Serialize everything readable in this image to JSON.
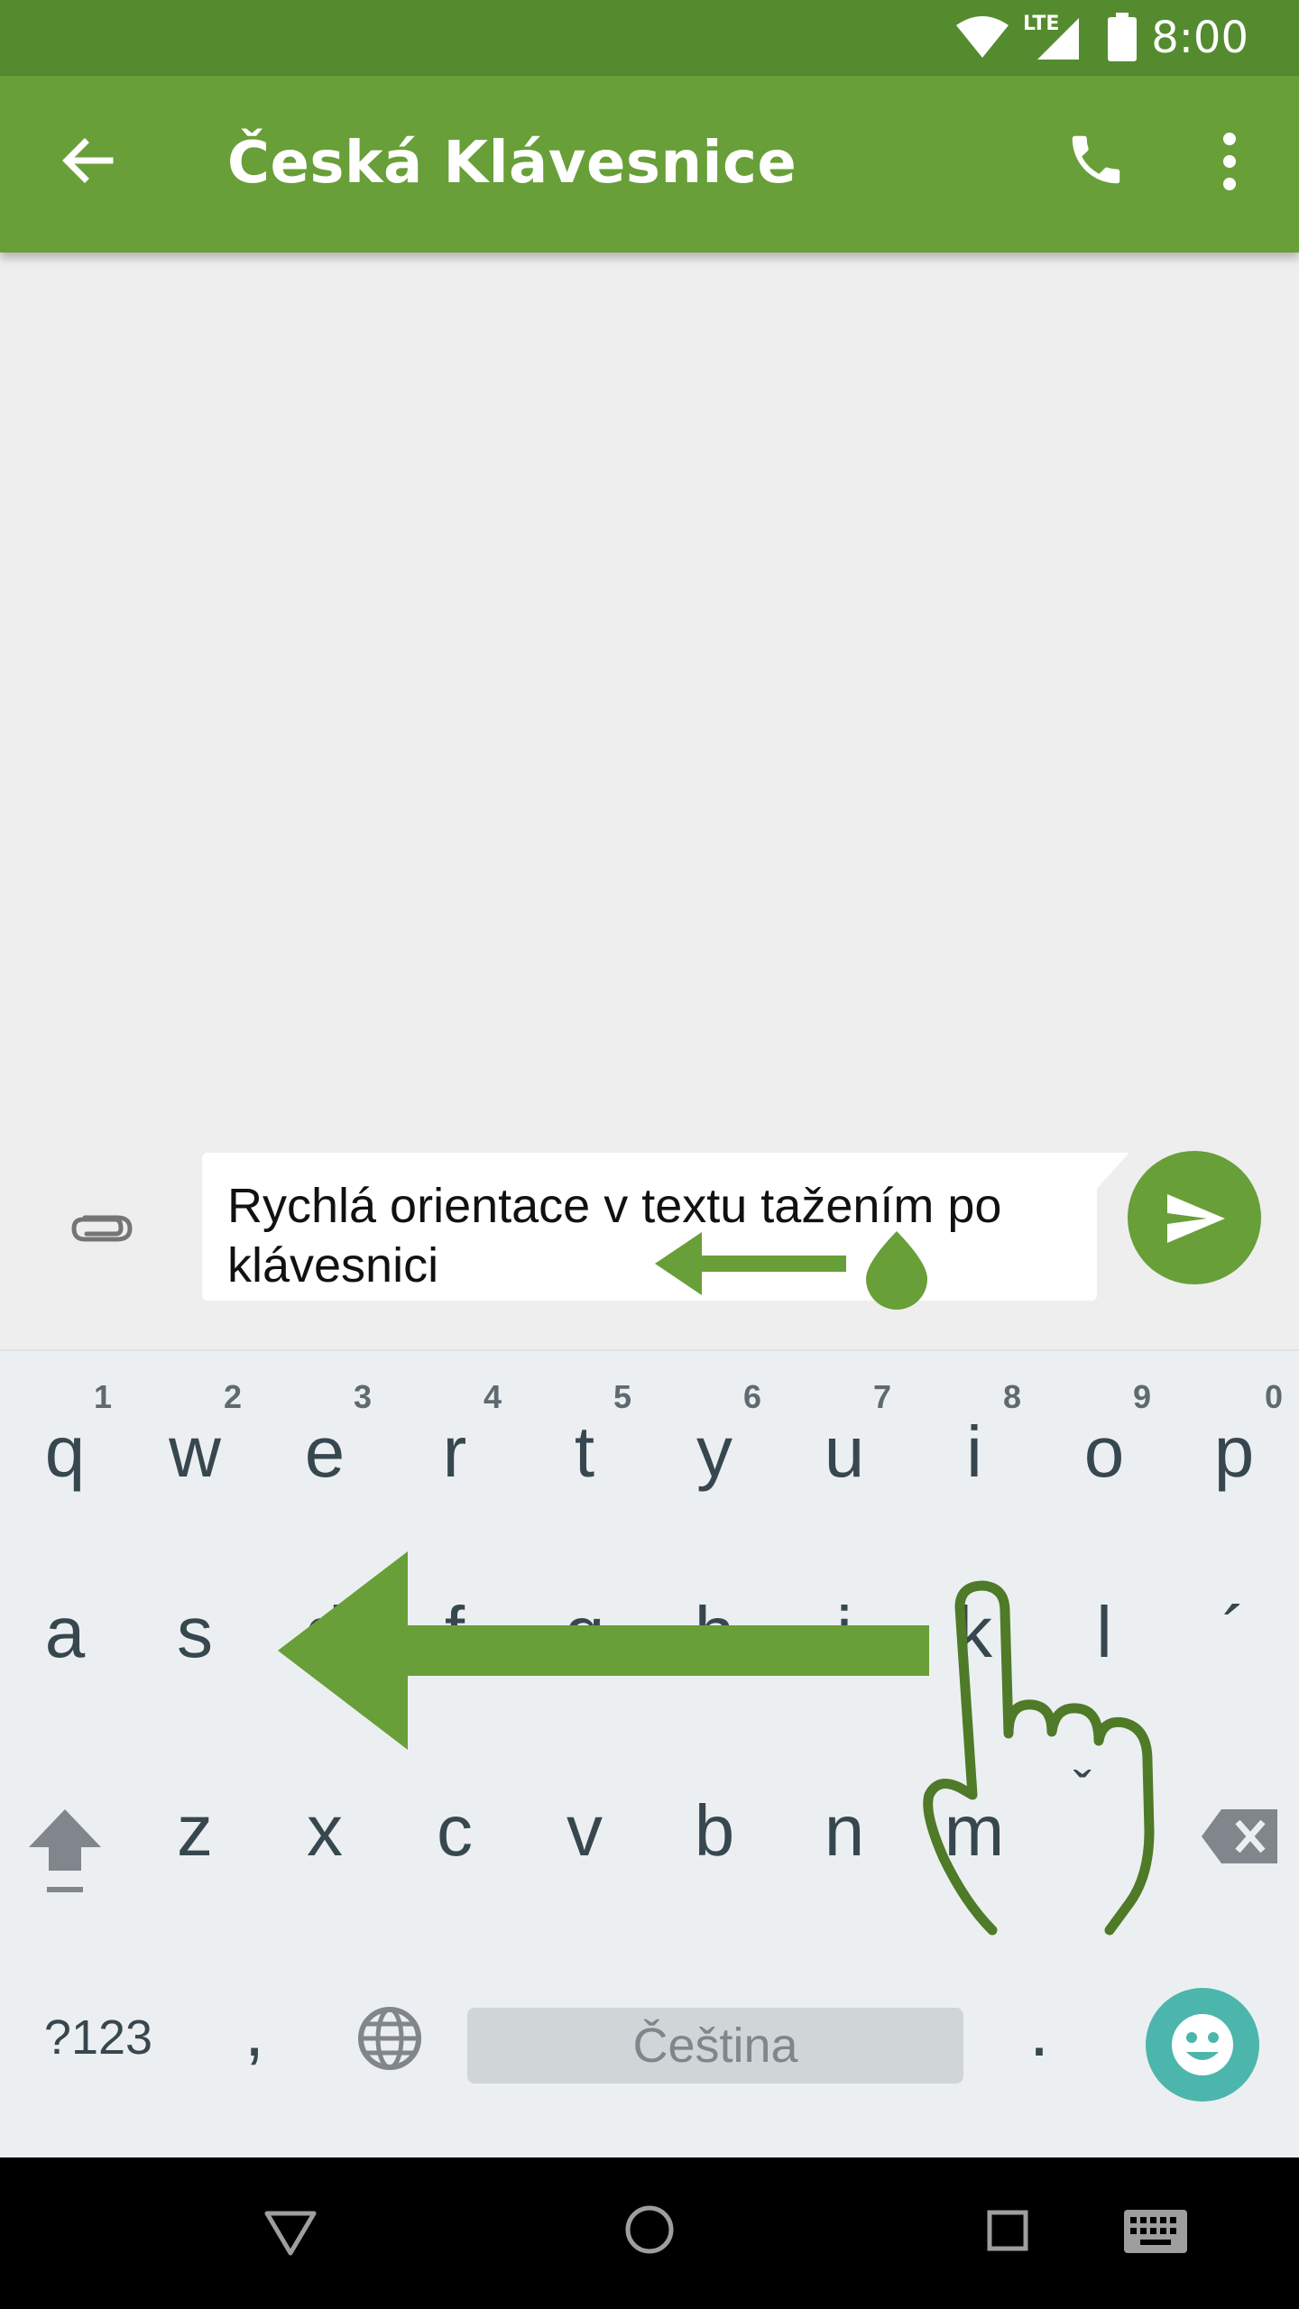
{
  "status_bar": {
    "time": "8:00",
    "network": "LTE"
  },
  "app_bar": {
    "title": "Česká Klávesnice"
  },
  "compose": {
    "message": "Rychlá orientace v textu tažením po klávesnici"
  },
  "keyboard": {
    "row1": [
      {
        "key": "q",
        "hint": "1"
      },
      {
        "key": "w",
        "hint": "2"
      },
      {
        "key": "e",
        "hint": "3"
      },
      {
        "key": "r",
        "hint": "4"
      },
      {
        "key": "t",
        "hint": "5"
      },
      {
        "key": "y",
        "hint": "6"
      },
      {
        "key": "u",
        "hint": "7"
      },
      {
        "key": "i",
        "hint": "8"
      },
      {
        "key": "o",
        "hint": "9"
      },
      {
        "key": "p",
        "hint": "0"
      }
    ],
    "row2": [
      "a",
      "s",
      "d",
      "f",
      "g",
      "h",
      "j",
      "k",
      "l",
      "´"
    ],
    "row3": [
      "z",
      "x",
      "c",
      "v",
      "b",
      "n",
      "m",
      "ˇ"
    ],
    "symbols_label": "?123",
    "comma": ",",
    "space_label": "Čeština",
    "period": "."
  },
  "colors": {
    "primary": "#689f38",
    "primary_dark": "#558b2f",
    "emoji_accent": "#4db6ac"
  },
  "icons": [
    "back-arrow-icon",
    "phone-icon",
    "more-vert-icon",
    "attach-icon",
    "send-icon",
    "shift-icon",
    "backspace-icon",
    "globe-icon",
    "emoji-icon"
  ]
}
